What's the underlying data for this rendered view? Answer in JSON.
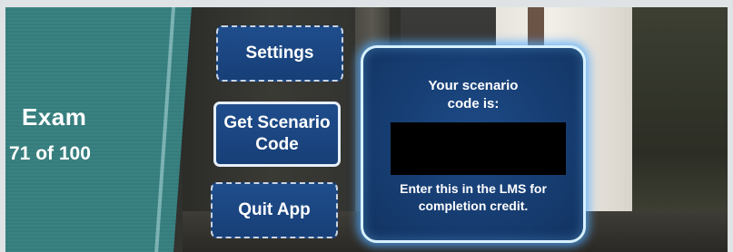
{
  "exam_panel": {
    "title": "Exam",
    "score": "71 of 100"
  },
  "menu": {
    "settings_label": "Settings",
    "scenario_label_line1": "Get Scenario",
    "scenario_label_line2": "Code",
    "quit_label": "Quit App"
  },
  "code_panel": {
    "heading_line1": "Your scenario",
    "heading_line2": "code is:",
    "code_value": "",
    "instructions_line1": "Enter this in the LMS for",
    "instructions_line2": "completion credit."
  },
  "colors": {
    "exam_panel_bg": "#3a8282",
    "button_bg": "#1f4d8c",
    "code_panel_bg": "#1d4a86",
    "code_panel_glow": "#50aaff"
  }
}
